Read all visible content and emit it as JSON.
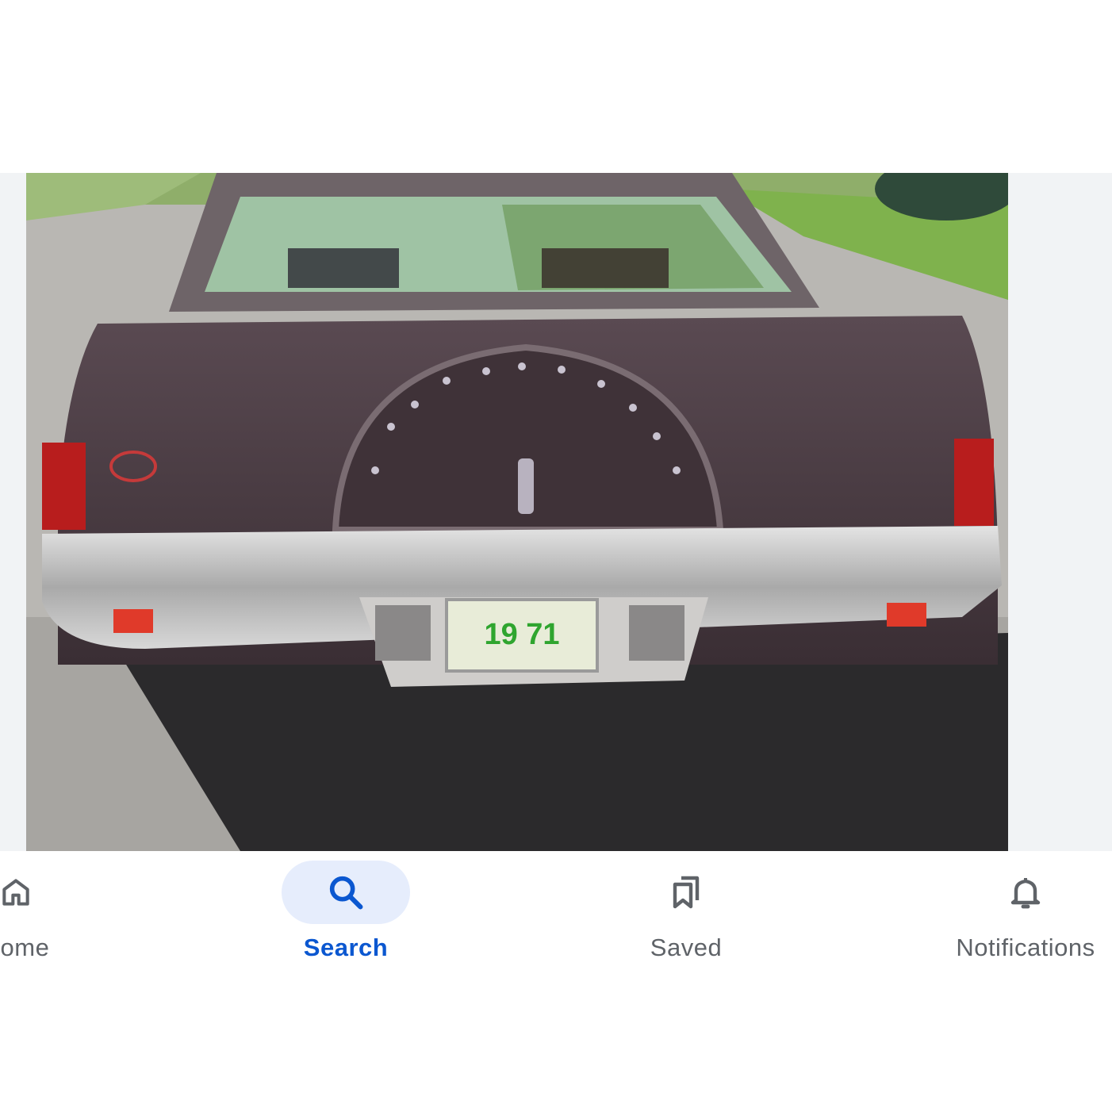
{
  "photo": {
    "alt": "",
    "plate_text": "19 71"
  },
  "bottom_nav": {
    "items": [
      {
        "label": "Home",
        "icon": "home-icon",
        "active": false
      },
      {
        "label": "Search",
        "icon": "search-icon",
        "active": true
      },
      {
        "label": "Saved",
        "icon": "saved-icon",
        "active": false
      },
      {
        "label": "Notifications",
        "icon": "bell-icon",
        "active": false
      }
    ]
  },
  "colors": {
    "accent": "#0b57d0",
    "active_pill": "#e6edfc",
    "inactive": "#5f6368",
    "viewer_bg": "#f1f3f5"
  }
}
